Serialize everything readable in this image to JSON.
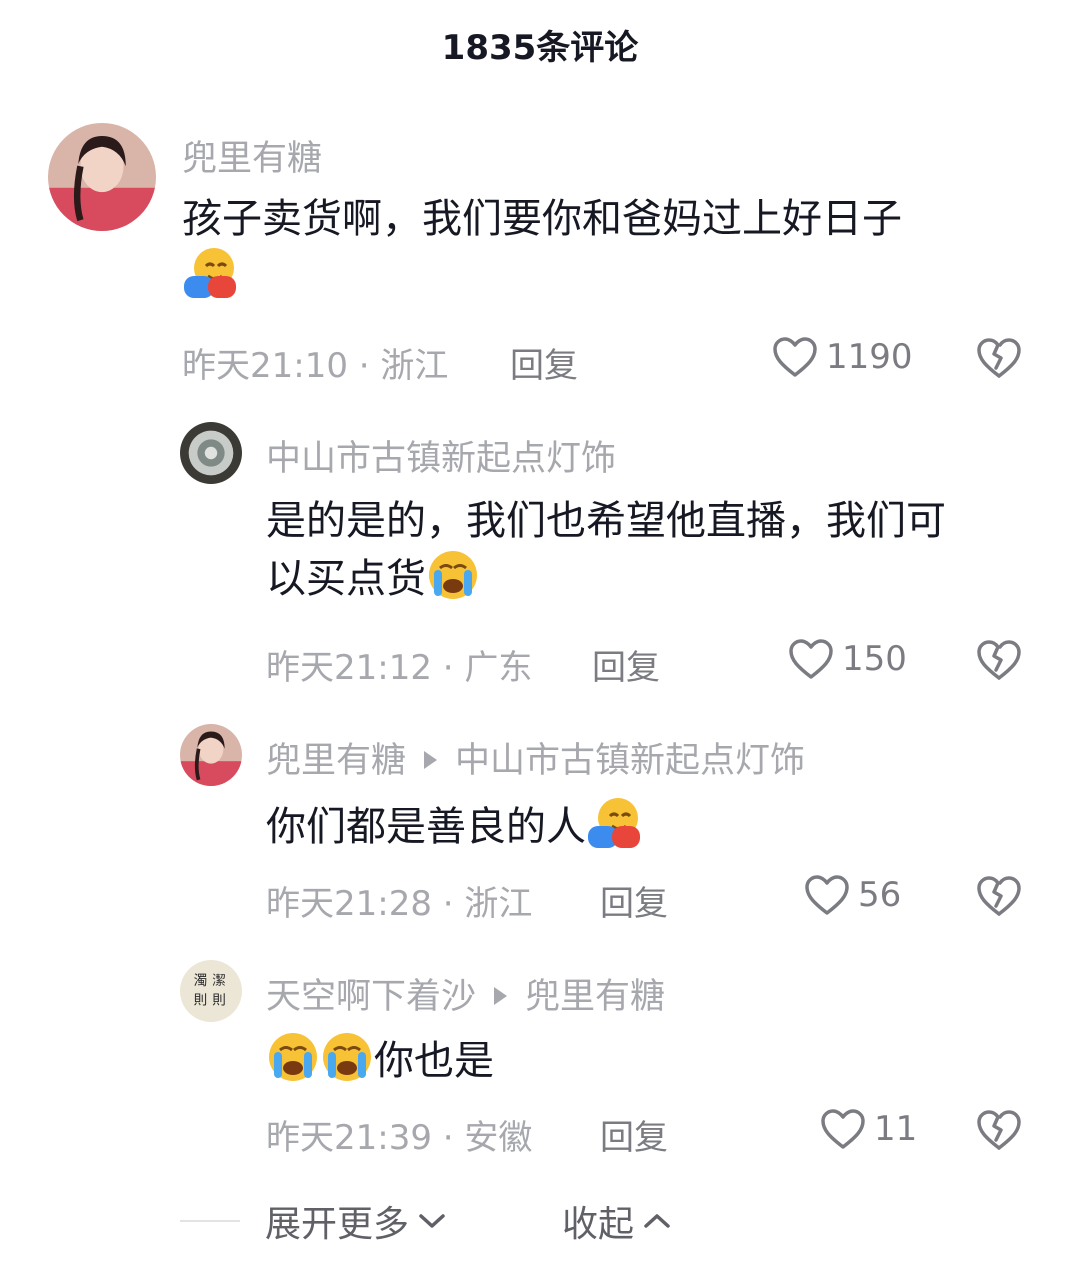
{
  "header": {
    "title": "1835条评论"
  },
  "comments": [
    {
      "username": "兜里有糖",
      "text": "孩子卖货啊，我们要你和爸妈过上好日子",
      "time": "昨天21:10 · 浙江",
      "reply": "回复",
      "likes": "1190"
    },
    {
      "username": "中山市古镇新起点灯饰",
      "text_line1": "是的是的，我们也希望他直播，我们可",
      "text_line2": "以买点货",
      "time": "昨天21:12 · 广东",
      "reply": "回复",
      "likes": "150"
    },
    {
      "username": "兜里有糖",
      "reply_to": "中山市古镇新起点灯饰",
      "text": "你们都是善良的人",
      "time": "昨天21:28 · 浙江",
      "reply": "回复",
      "likes": "56"
    },
    {
      "username": "天空啊下着沙",
      "reply_to": "兜里有糖",
      "text": "你也是",
      "time": "昨天21:39 · 安徽",
      "reply": "回复",
      "likes": "11"
    }
  ],
  "footer": {
    "expand": "展开更多",
    "collapse": "收起"
  },
  "icons": {
    "like": "heart-outline-icon",
    "dislike": "broken-heart-icon",
    "hug": "hugging-face-emoji",
    "cry": "loudly-crying-face-emoji"
  },
  "colors": {
    "text": "#161823",
    "secondary": "#a6a8ad",
    "action": "#7a7c82"
  }
}
